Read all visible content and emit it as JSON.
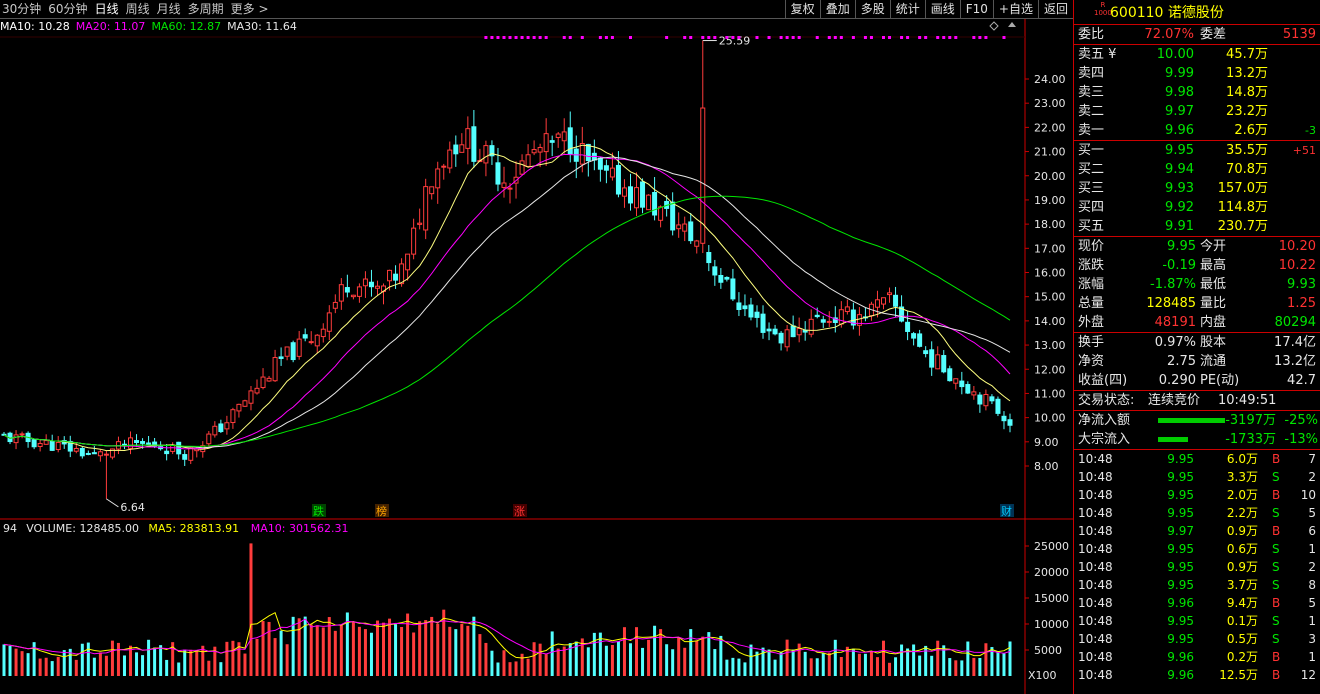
{
  "toolbar": {
    "periods": [
      "30分钟",
      "60分钟",
      "日线",
      "周线",
      "月线",
      "多周期",
      "更多 >"
    ],
    "active_period": "日线",
    "tools": [
      "复权",
      "叠加",
      "多股",
      "统计",
      "画线",
      "F10",
      "+自选",
      "返回"
    ]
  },
  "ma_legend": [
    {
      "label": "MA10: 10.28",
      "color": "#ffffff"
    },
    {
      "label": "MA20: 11.07",
      "color": "#ff00ff"
    },
    {
      "label": "MA60: 12.87",
      "color": "#00e600"
    },
    {
      "label": "MA30: 11.64",
      "color": "#e6e6e6"
    }
  ],
  "volume_legend": [
    {
      "label": "94",
      "color": "#e6e6e6"
    },
    {
      "label": "VOLUME: 128485.00",
      "color": "#e6e6e6"
    },
    {
      "label": "MA5: 283813.91",
      "color": "#ffff00"
    },
    {
      "label": "MA10: 301562.31",
      "color": "#ff00ff"
    }
  ],
  "chart_data": {
    "type": "candlestick",
    "price_axis": [
      "24.00",
      "23.00",
      "22.00",
      "21.00",
      "20.00",
      "19.00",
      "18.00",
      "17.00",
      "16.00",
      "15.00",
      "14.00",
      "13.00",
      "12.00",
      "11.00",
      "10.00",
      "9.00",
      "8.00"
    ],
    "volume_axis": [
      "25000",
      "20000",
      "15000",
      "10000",
      "5000"
    ],
    "volume_unit": "X100",
    "high_label": "25.59",
    "low_label": "6.64",
    "price_ylim": [
      8.0,
      24.0
    ],
    "volume_ylim": [
      0,
      25000
    ],
    "markers": [
      {
        "text": "跌",
        "color": "#00e600",
        "bg": "#004400"
      },
      {
        "text": "榜",
        "color": "#ffa500",
        "bg": "#442200"
      },
      {
        "text": "涨",
        "color": "#ff3232",
        "bg": "#440000"
      },
      {
        "text": "财",
        "color": "#00ccff",
        "bg": "#003355"
      }
    ],
    "ma_colors": {
      "ma10": "#ffff80",
      "ma20": "#ff00ff",
      "ma30": "#e6e6e6",
      "ma60": "#00e600"
    }
  },
  "quote": {
    "badge_top": "R",
    "badge_bottom": "1000",
    "code_name": "600110 诺德股份",
    "weibi_label": "委比",
    "weibi_value": "72.07%",
    "weicha_label": "委差",
    "weicha_value": "5139",
    "sells": [
      {
        "label": "卖五 ¥",
        "price": "10.00",
        "vol": "45.7万",
        "delta": ""
      },
      {
        "label": "卖四",
        "price": "9.99",
        "vol": "13.2万",
        "delta": ""
      },
      {
        "label": "卖三",
        "price": "9.98",
        "vol": "14.8万",
        "delta": ""
      },
      {
        "label": "卖二",
        "price": "9.97",
        "vol": "23.2万",
        "delta": ""
      },
      {
        "label": "卖一",
        "price": "9.96",
        "vol": "2.6万",
        "delta": "-3"
      }
    ],
    "buys": [
      {
        "label": "买一",
        "price": "9.95",
        "vol": "35.5万",
        "delta": "+51"
      },
      {
        "label": "买二",
        "price": "9.94",
        "vol": "70.8万",
        "delta": ""
      },
      {
        "label": "买三",
        "price": "9.93",
        "vol": "157.0万",
        "delta": ""
      },
      {
        "label": "买四",
        "price": "9.92",
        "vol": "114.8万",
        "delta": ""
      },
      {
        "label": "买五",
        "price": "9.91",
        "vol": "230.7万",
        "delta": ""
      }
    ],
    "stats": [
      {
        "l1": "现价",
        "v1": "9.95",
        "c1": "green",
        "l2": "今开",
        "v2": "10.20",
        "c2": "red"
      },
      {
        "l1": "涨跌",
        "v1": "-0.19",
        "c1": "green",
        "l2": "最高",
        "v2": "10.22",
        "c2": "red"
      },
      {
        "l1": "涨幅",
        "v1": "-1.87%",
        "c1": "green",
        "l2": "最低",
        "v2": "9.93",
        "c2": "green"
      },
      {
        "l1": "总量",
        "v1": "128485",
        "c1": "yellow",
        "l2": "量比",
        "v2": "1.25",
        "c2": "red"
      },
      {
        "l1": "外盘",
        "v1": "48191",
        "c1": "red",
        "l2": "内盘",
        "v2": "80294",
        "c2": "green"
      }
    ],
    "stats2": [
      {
        "l1": "换手",
        "v1": "0.97%",
        "c1": "white",
        "l2": "股本",
        "v2": "17.4亿",
        "c2": "white"
      },
      {
        "l1": "净资",
        "v1": "2.75",
        "c1": "white",
        "l2": "流通",
        "v2": "13.2亿",
        "c2": "white"
      },
      {
        "l1": "收益(四)",
        "v1": "0.290",
        "c1": "white",
        "l2": "PE(动)",
        "v2": "42.7",
        "c2": "white"
      }
    ],
    "trade_status_label": "交易状态:",
    "trade_status": "连续竞价",
    "trade_time": "10:49:51",
    "flows": [
      {
        "label": "净流入额",
        "value": "-3197万",
        "pct": "-25%",
        "bar": 0.8
      },
      {
        "label": "大宗流入",
        "value": "-1733万",
        "pct": "-13%",
        "bar": 0.36
      }
    ],
    "ticks": [
      {
        "time": "10:48",
        "price": "9.95",
        "pc": "green",
        "vol": "6.0万",
        "bs": "B",
        "n": "7"
      },
      {
        "time": "10:48",
        "price": "9.95",
        "pc": "green",
        "vol": "3.3万",
        "bs": "S",
        "n": "2"
      },
      {
        "time": "10:48",
        "price": "9.95",
        "pc": "green",
        "vol": "2.0万",
        "bs": "B",
        "n": "10"
      },
      {
        "time": "10:48",
        "price": "9.95",
        "pc": "green",
        "vol": "2.2万",
        "bs": "S",
        "n": "5"
      },
      {
        "time": "10:48",
        "price": "9.97",
        "pc": "green",
        "vol": "0.9万",
        "bs": "B",
        "n": "6"
      },
      {
        "time": "10:48",
        "price": "9.95",
        "pc": "green",
        "vol": "0.6万",
        "bs": "S",
        "n": "1"
      },
      {
        "time": "10:48",
        "price": "9.95",
        "pc": "green",
        "vol": "0.9万",
        "bs": "S",
        "n": "2"
      },
      {
        "time": "10:48",
        "price": "9.95",
        "pc": "green",
        "vol": "3.7万",
        "bs": "S",
        "n": "8"
      },
      {
        "time": "10:48",
        "price": "9.96",
        "pc": "green",
        "vol": "9.4万",
        "bs": "B",
        "n": "5"
      },
      {
        "time": "10:48",
        "price": "9.95",
        "pc": "green",
        "vol": "0.1万",
        "bs": "S",
        "n": "1"
      },
      {
        "time": "10:48",
        "price": "9.95",
        "pc": "green",
        "vol": "0.5万",
        "bs": "S",
        "n": "3"
      },
      {
        "time": "10:48",
        "price": "9.96",
        "pc": "green",
        "vol": "0.2万",
        "bs": "B",
        "n": "1"
      },
      {
        "time": "10:48",
        "price": "9.96",
        "pc": "green",
        "vol": "12.5万",
        "bs": "B",
        "n": "12"
      }
    ]
  }
}
